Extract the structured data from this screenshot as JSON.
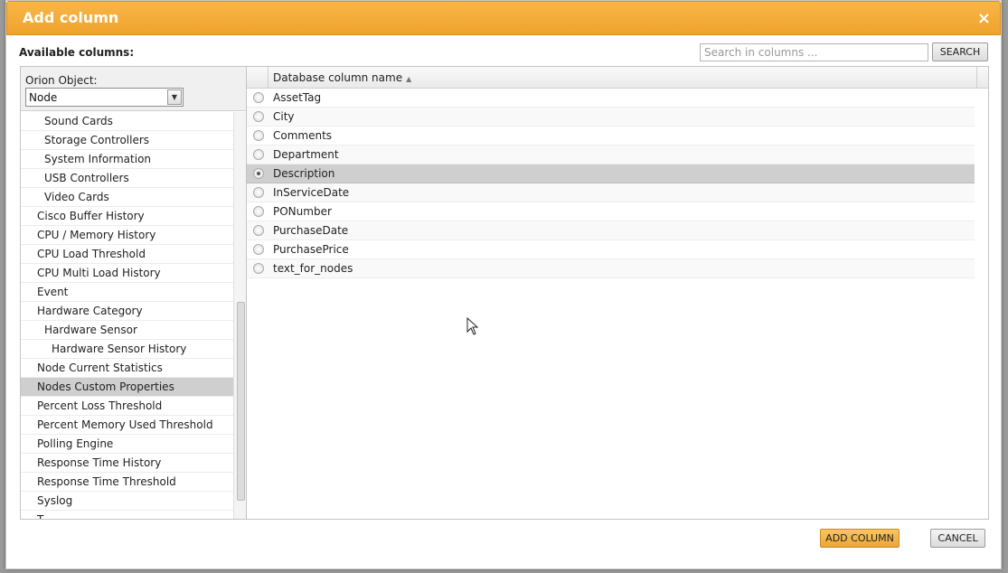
{
  "dialog": {
    "title": "Add column",
    "close_symbol": "×"
  },
  "available_label": "Available columns:",
  "search": {
    "placeholder": "Search in columns ...",
    "button_label": "SEARCH"
  },
  "object_selector": {
    "label": "Orion Object:",
    "value": "Node"
  },
  "tree_items": [
    {
      "label": "Sound Cards",
      "level": 1
    },
    {
      "label": "Storage Controllers",
      "level": 1
    },
    {
      "label": "System Information",
      "level": 1
    },
    {
      "label": "USB Controllers",
      "level": 1
    },
    {
      "label": "Video Cards",
      "level": 1
    },
    {
      "label": "Cisco Buffer History",
      "level": 0
    },
    {
      "label": "CPU / Memory History",
      "level": 0
    },
    {
      "label": "CPU Load Threshold",
      "level": 0
    },
    {
      "label": "CPU Multi Load History",
      "level": 0
    },
    {
      "label": "Event",
      "level": 0
    },
    {
      "label": "Hardware Category",
      "level": 0
    },
    {
      "label": "Hardware Sensor",
      "level": 1
    },
    {
      "label": "Hardware Sensor History",
      "level": 2
    },
    {
      "label": "Node Current Statistics",
      "level": 0
    },
    {
      "label": "Nodes Custom Properties",
      "level": 0,
      "selected": true
    },
    {
      "label": "Percent Loss Threshold",
      "level": 0
    },
    {
      "label": "Percent Memory Used Threshold",
      "level": 0
    },
    {
      "label": "Polling Engine",
      "level": 0
    },
    {
      "label": "Response Time History",
      "level": 0
    },
    {
      "label": "Response Time Threshold",
      "level": 0
    },
    {
      "label": "Syslog",
      "level": 0
    },
    {
      "label": "T...",
      "level": 0
    }
  ],
  "columns_table": {
    "header": "Database column name",
    "rows": [
      {
        "name": "AssetTag",
        "checked": false
      },
      {
        "name": "City",
        "checked": false
      },
      {
        "name": "Comments",
        "checked": false
      },
      {
        "name": "Department",
        "checked": false
      },
      {
        "name": "Description",
        "checked": true
      },
      {
        "name": "InServiceDate",
        "checked": false
      },
      {
        "name": "PONumber",
        "checked": false
      },
      {
        "name": "PurchaseDate",
        "checked": false
      },
      {
        "name": "PurchasePrice",
        "checked": false
      },
      {
        "name": "text_for_nodes",
        "checked": false
      }
    ]
  },
  "footer": {
    "add_label": "ADD COLUMN",
    "cancel_label": "CANCEL"
  },
  "icons": {
    "close": "close-icon",
    "dropdown": "chevron-down-icon",
    "sort": "sort-ascending-icon",
    "cursor": "mouse-pointer-icon"
  },
  "colors": {
    "title_bar": "#f0a32c",
    "selected_row": "#cfcfcf",
    "primary_button": "#eda636"
  }
}
